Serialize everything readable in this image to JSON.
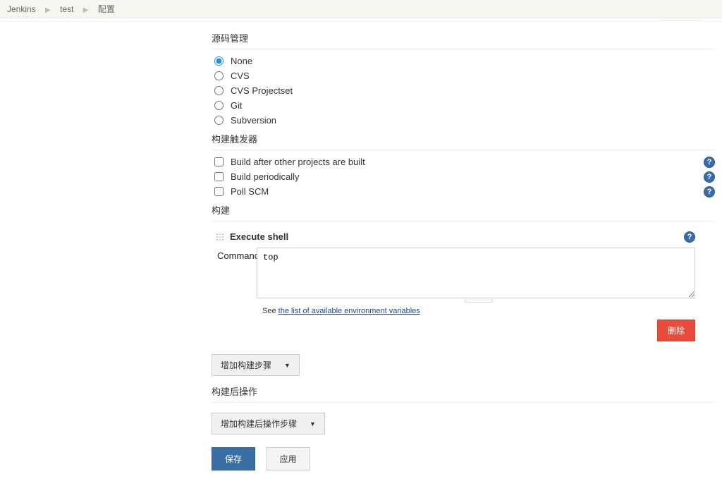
{
  "breadcrumb": [
    "Jenkins",
    "test",
    "配置"
  ],
  "scm": {
    "title": "源码管理",
    "options": [
      "None",
      "CVS",
      "CVS Projectset",
      "Git",
      "Subversion"
    ],
    "selected": "None"
  },
  "triggers": {
    "title": "构建触发器",
    "items": [
      {
        "label": "Build after other projects are built",
        "help": true
      },
      {
        "label": "Build periodically",
        "help": true
      },
      {
        "label": "Poll SCM",
        "help": true
      }
    ]
  },
  "build": {
    "title": "构建",
    "step_title": "Execute shell",
    "command_label": "Command",
    "command_value": "top",
    "see_prefix": "See ",
    "see_link": "the list of available environment variables",
    "delete_label": "删除",
    "add_step_label": "增加构建步骤"
  },
  "post_build": {
    "title": "构建后操作",
    "add_label": "增加构建后操作步骤"
  },
  "buttons": {
    "save": "保存",
    "apply": "应用"
  }
}
